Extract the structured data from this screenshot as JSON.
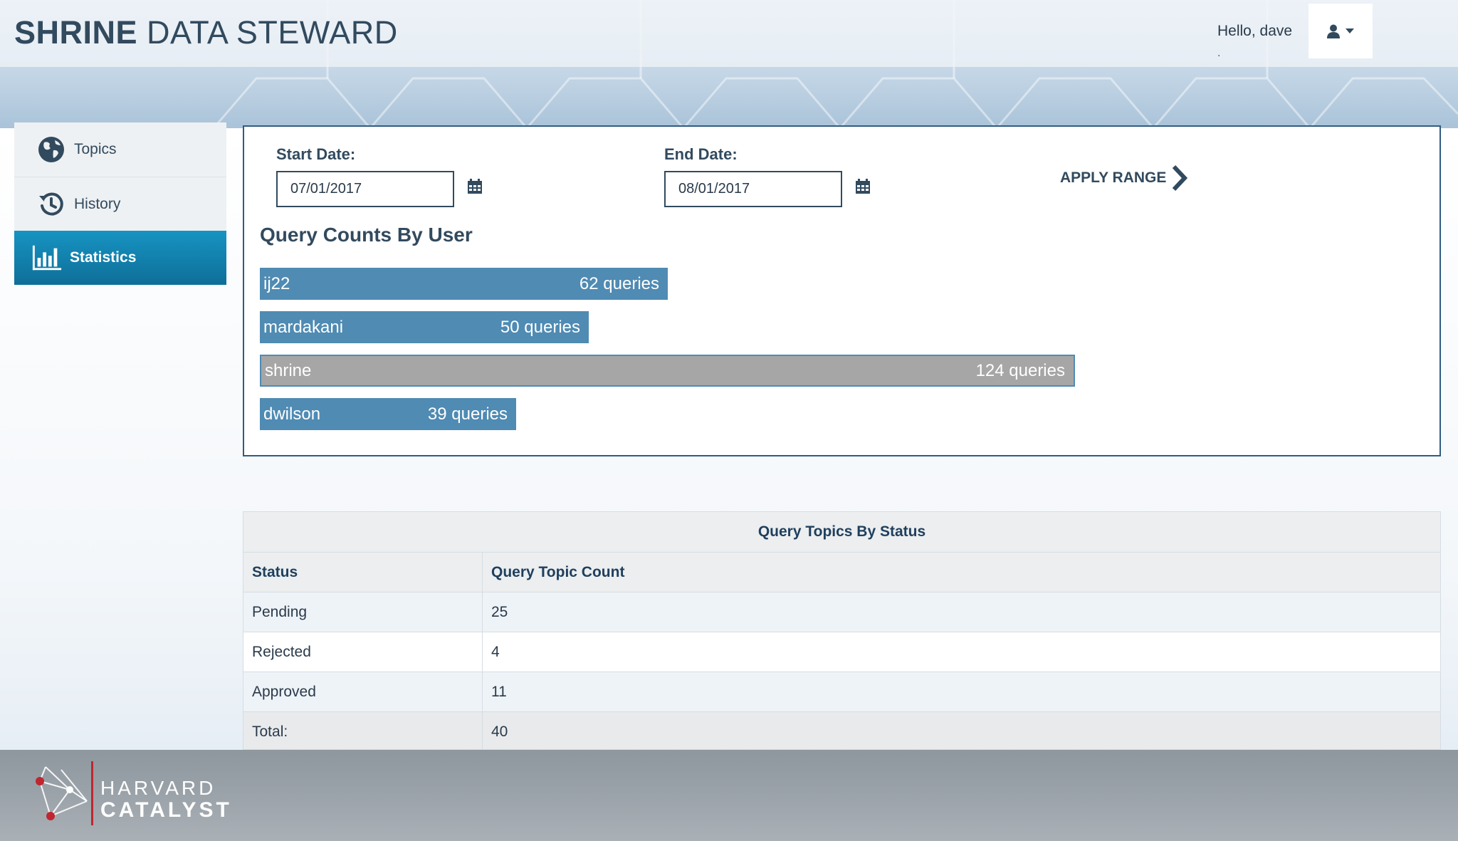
{
  "header": {
    "brand_bold": "SHRINE",
    "brand_rest": "DATA STEWARD",
    "greeting": "Hello, dave",
    "greeting_sub": "."
  },
  "sidebar": {
    "items": [
      {
        "label": "Topics",
        "icon": "globe-icon"
      },
      {
        "label": "History",
        "icon": "history-icon"
      },
      {
        "label": "Statistics",
        "icon": "bar-chart-icon",
        "active": true
      }
    ]
  },
  "filters": {
    "start_label": "Start Date:",
    "start_value": "07/01/2017",
    "end_label": "End Date:",
    "end_value": "08/01/2017",
    "apply_label": "APPLY RANGE"
  },
  "query_counts": {
    "title": "Query Counts By User"
  },
  "chart_data": {
    "type": "bar",
    "orientation": "horizontal",
    "title": "Query Counts By User",
    "categories": [
      "ij22",
      "mardakani",
      "shrine",
      "dwilson"
    ],
    "values": [
      62,
      50,
      124,
      39
    ],
    "value_labels": [
      "62 queries",
      "50 queries",
      "124 queries",
      "39 queries"
    ],
    "colors": [
      "#4f8bb3",
      "#4f8bb3",
      "#a6a6a6",
      "#4f8bb3"
    ]
  },
  "status_table": {
    "caption": "Query Topics By Status",
    "headers": [
      "Status",
      "Query Topic Count"
    ],
    "rows": [
      {
        "status": "Pending",
        "count": "25"
      },
      {
        "status": "Rejected",
        "count": "4"
      },
      {
        "status": "Approved",
        "count": "11"
      },
      {
        "status": "Total:",
        "count": "40"
      }
    ]
  },
  "footer": {
    "logo_line1": "HARVARD",
    "logo_line2": "CATALYST"
  },
  "colors": {
    "brand": "#324a5e",
    "accent": "#1793c2",
    "bar": "#4f8bb3",
    "bar_highlight": "#a6a6a6"
  }
}
